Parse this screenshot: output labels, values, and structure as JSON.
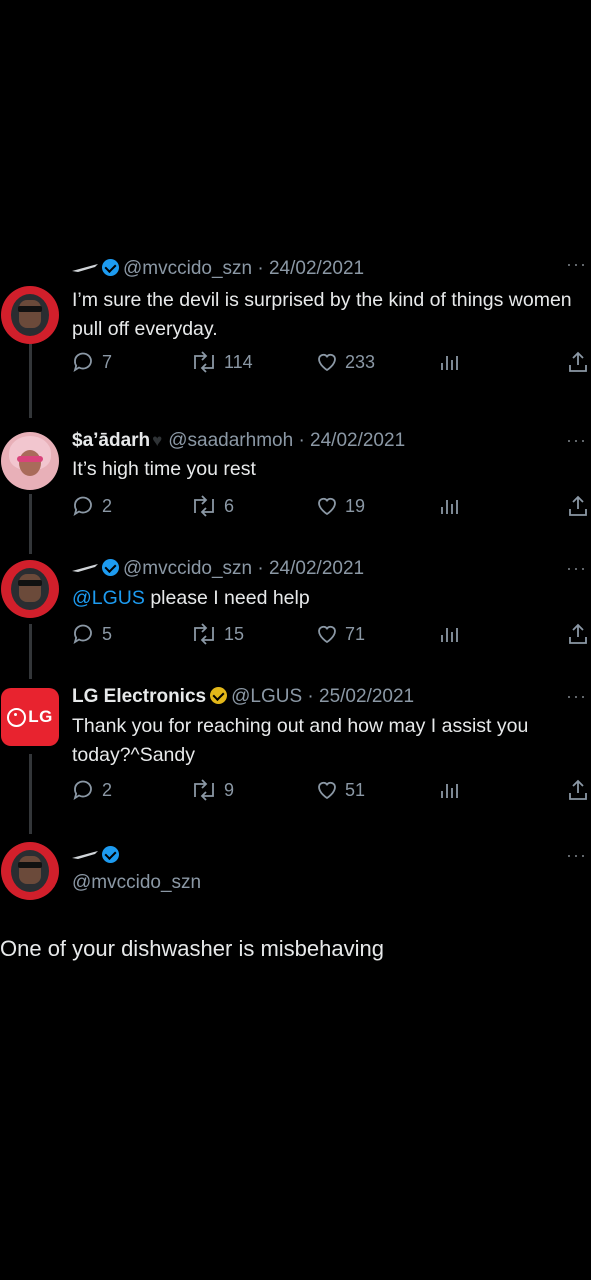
{
  "tweets": [
    {
      "handle": "@mvccido_szn · 24/02/2021",
      "body": "I’m sure the devil is surprised by the kind of things women pull off everyday.",
      "replies": "7",
      "retweets": "114",
      "likes": "233"
    },
    {
      "name": "$a’ādarh",
      "handle": "@saadarhmoh · 24/02/2021",
      "body": "It’s high time you rest",
      "replies": "2",
      "retweets": "6",
      "likes": "19"
    },
    {
      "handle": "@mvccido_szn · 24/02/2021",
      "mention": "@LGUS",
      "body": " please I need help",
      "replies": "5",
      "retweets": "15",
      "likes": "71"
    },
    {
      "name": "LG Electronics",
      "handle": "@LGUS · 25/02/2021",
      "avatar_text": "LG",
      "body": "Thank you for reaching out and how may I assist you today?^Sandy",
      "replies": "2",
      "retweets": "9",
      "likes": "51"
    },
    {
      "handle": "@mvccido_szn"
    }
  ],
  "caption": "One of your dishwasher is misbehaving",
  "icons": [
    "reply-icon",
    "retweet-icon",
    "like-icon",
    "views-icon",
    "share-icon",
    "verified-badge-icon",
    "more-icon"
  ],
  "colors": {
    "accent": "#1d9bf0",
    "gold_badge": "#e2b719",
    "lg_red": "#e8232f"
  }
}
